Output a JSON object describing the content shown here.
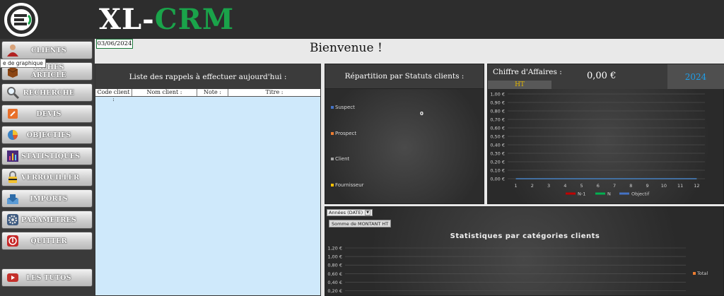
{
  "app": {
    "title_part1": "XL-",
    "title_part2": "CRM",
    "title_color1": "#ffffff",
    "title_color2": "#1aa34a",
    "logo_icon": "xl-crm-logo-icon"
  },
  "sidebar": {
    "tooltip": "e de graphique",
    "items": [
      {
        "label": "CLIENTS",
        "icon": "user-icon"
      },
      {
        "label": "FICHES ARTICLE",
        "icon": "box-icon"
      },
      {
        "label": "RECHERCHE",
        "icon": "magnifier-icon"
      },
      {
        "label": "DEVIS",
        "icon": "document-icon"
      },
      {
        "label": "OBJECTIFS",
        "icon": "pie-chart-icon"
      },
      {
        "label": "STATISTIQUES",
        "icon": "bar-chart-icon"
      },
      {
        "label": "VERROUILLER",
        "icon": "padlock-icon"
      },
      {
        "label": "IMPORTS",
        "icon": "import-icon"
      },
      {
        "label": "PARAMETRES",
        "icon": "gear-icon"
      },
      {
        "label": "QUITTER",
        "icon": "exit-icon"
      },
      {
        "label": "LES TUTOS",
        "icon": "youtube-icon"
      }
    ]
  },
  "main": {
    "date": "03/06/2024",
    "welcome": "Bienvenue !"
  },
  "reminders": {
    "title": "Liste des rappels à effectuer aujourd'hui :",
    "columns": [
      "Code client :",
      "Nom client :",
      "Note :",
      "Titre :"
    ],
    "rows": []
  },
  "pie_panel": {
    "title": "Répartition par Statuts clients :",
    "legend": [
      {
        "label": "Suspect",
        "color": "#4472c4"
      },
      {
        "label": "Prospect",
        "color": "#ed7d31"
      },
      {
        "label": "Client",
        "color": "#a5a5a5"
      },
      {
        "label": "Fournisseur",
        "color": "#ffc000"
      }
    ],
    "value_label": "0"
  },
  "ca_panel": {
    "title": "Chiffre d'Affaires :",
    "ht_label": "HT",
    "amount": "0,00 €",
    "year": "2024"
  },
  "stats_panel": {
    "filter_label": "Années (DATE)",
    "sum_label": "Somme de MONTANT HT",
    "title": "Statistiques par catégories clients"
  },
  "chart_data": [
    {
      "type": "line",
      "categories": [
        "1",
        "2",
        "3",
        "4",
        "5",
        "6",
        "7",
        "8",
        "9",
        "10",
        "11",
        "12"
      ],
      "y_ticks": [
        "1,00 €",
        "0,90 €",
        "0,80 €",
        "0,70 €",
        "0,60 €",
        "0,50 €",
        "0,40 €",
        "0,30 €",
        "0,20 €",
        "0,10 €",
        "0,00 €"
      ],
      "ylim": [
        0,
        1
      ],
      "grid": true,
      "legend_position": "bottom",
      "series": [
        {
          "name": "N-1",
          "color": "#c00000",
          "values": [
            0,
            0,
            0,
            0,
            0,
            0,
            0,
            0,
            0,
            0,
            0,
            0
          ]
        },
        {
          "name": "N",
          "color": "#00b050",
          "values": [
            0,
            0,
            0,
            0,
            0,
            0,
            0,
            0,
            0,
            0,
            0,
            0
          ]
        },
        {
          "name": "Objectif",
          "color": "#4472c4",
          "values": [
            0,
            0,
            0,
            0,
            0,
            0,
            0,
            0,
            0,
            0,
            0,
            0
          ]
        }
      ]
    },
    {
      "type": "bar",
      "title": "Statistiques par catégories clients",
      "y_ticks": [
        "1,20 €",
        "1,00 €",
        "0,80 €",
        "0,60 €",
        "0,40 €",
        "0,20 €"
      ],
      "ylim": [
        0,
        1.2
      ],
      "grid": true,
      "legend_position": "right",
      "series": [
        {
          "name": "Total",
          "color": "#ed7d31",
          "values": []
        }
      ]
    }
  ]
}
